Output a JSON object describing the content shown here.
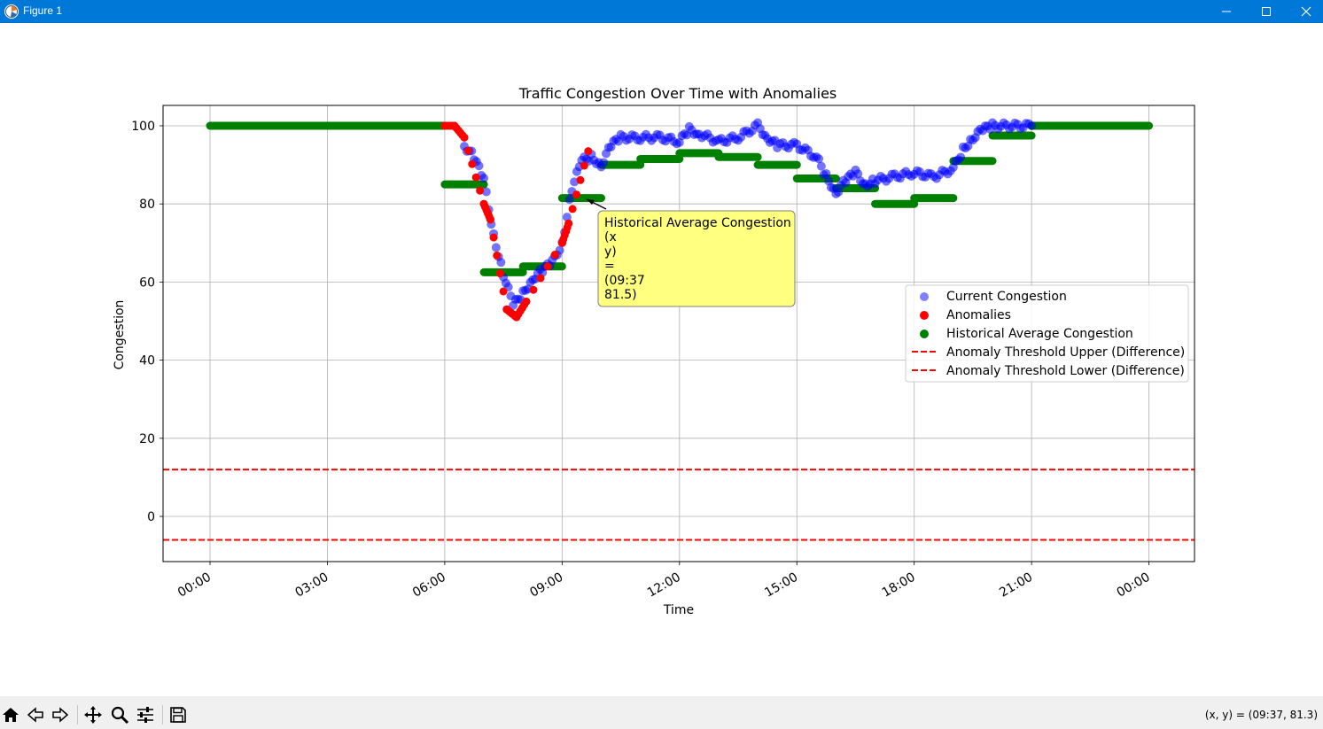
{
  "window": {
    "title": "Figure 1",
    "titlebar_color": "#0078d7",
    "controls": [
      "minimize-icon",
      "maximize-icon",
      "close-icon"
    ]
  },
  "chart_data": {
    "type": "scatter",
    "title": "Traffic Congestion Over Time with Anomalies",
    "xlabel": "Time",
    "ylabel": "Congestion",
    "xlim": [
      "23:14",
      "24:00 (+1h14)"
    ],
    "ylim": [
      -11.5,
      105
    ],
    "x_ticks": [
      "00:00",
      "03:00",
      "06:00",
      "09:00",
      "12:00",
      "15:00",
      "18:00",
      "21:00",
      "00:00"
    ],
    "y_ticks": [
      "0",
      "20",
      "40",
      "60",
      "80",
      "100"
    ],
    "grid": true,
    "legend_position": "center-right",
    "legend": [
      "Current Congestion",
      "Anomalies",
      "Historical Average Congestion",
      "Anomaly Threshold Upper (Difference)",
      "Anomaly Threshold Lower (Difference)"
    ],
    "colors": {
      "current": "#0000ff",
      "anomaly": "#ff0000",
      "historical": "#008000",
      "threshold": "#ff0000",
      "annotation_bg": "#ffff80"
    },
    "series": [
      {
        "name": "Current Congestion",
        "points": [
          [
            "06:30",
            95
          ],
          [
            "06:45",
            92
          ],
          [
            "07:00",
            86
          ],
          [
            "07:15",
            72
          ],
          [
            "07:30",
            62
          ],
          [
            "07:45",
            54
          ],
          [
            "08:00",
            57
          ],
          [
            "08:15",
            61
          ],
          [
            "08:30",
            63
          ],
          [
            "08:45",
            65
          ],
          [
            "09:00",
            70
          ],
          [
            "09:15",
            84
          ],
          [
            "09:30",
            91
          ],
          [
            "09:45",
            92
          ],
          [
            "10:00",
            90
          ],
          [
            "10:15",
            95
          ],
          [
            "10:30",
            97
          ],
          [
            "11:00",
            97
          ],
          [
            "11:30",
            97
          ],
          [
            "12:00",
            96
          ],
          [
            "12:15",
            99
          ],
          [
            "12:30",
            98
          ],
          [
            "13:00",
            96
          ],
          [
            "13:30",
            97
          ],
          [
            "14:00",
            100
          ],
          [
            "14:15",
            97
          ],
          [
            "14:30",
            95
          ],
          [
            "15:00",
            95
          ],
          [
            "15:30",
            92
          ],
          [
            "15:45",
            87
          ],
          [
            "16:00",
            83
          ],
          [
            "16:15",
            86
          ],
          [
            "16:30",
            88
          ],
          [
            "16:45",
            85
          ],
          [
            "17:00",
            86
          ],
          [
            "17:30",
            87
          ],
          [
            "18:00",
            88
          ],
          [
            "18:30",
            87
          ],
          [
            "19:00",
            89
          ],
          [
            "19:15",
            94
          ],
          [
            "19:30",
            97
          ],
          [
            "19:45",
            99
          ],
          [
            "20:00",
            100
          ],
          [
            "21:00",
            100
          ]
        ]
      },
      {
        "name": "Anomalies",
        "points": [
          [
            "06:00",
            100
          ],
          [
            "06:15",
            100
          ],
          [
            "06:30",
            97
          ],
          [
            "07:00",
            80
          ],
          [
            "07:10",
            76
          ],
          [
            "07:35",
            53
          ],
          [
            "07:50",
            51
          ],
          [
            "08:05",
            55
          ],
          [
            "09:00",
            70
          ],
          [
            "09:10",
            75
          ],
          [
            "09:40",
            93.5
          ]
        ]
      },
      {
        "name": "Historical Average Congestion",
        "segments": [
          [
            "00:00",
            "06:00",
            100
          ],
          [
            "06:00",
            "07:00",
            85
          ],
          [
            "07:00",
            "08:00",
            62.5
          ],
          [
            "08:00",
            "09:00",
            64
          ],
          [
            "09:00",
            "10:00",
            81.5
          ],
          [
            "10:00",
            "11:00",
            90
          ],
          [
            "11:00",
            "12:00",
            91.5
          ],
          [
            "12:00",
            "13:00",
            93
          ],
          [
            "13:00",
            "14:00",
            92
          ],
          [
            "14:00",
            "15:00",
            90
          ],
          [
            "15:00",
            "16:00",
            86.5
          ],
          [
            "16:00",
            "17:00",
            84
          ],
          [
            "17:00",
            "18:00",
            80
          ],
          [
            "18:00",
            "19:00",
            81.5
          ],
          [
            "19:00",
            "20:00",
            91
          ],
          [
            "20:00",
            "21:00",
            97.5
          ],
          [
            "21:00",
            "24:00",
            100
          ]
        ]
      },
      {
        "name": "Anomaly Threshold Upper (Difference)",
        "value": 12
      },
      {
        "name": "Anomaly Threshold Lower (Difference)",
        "value": -6
      }
    ],
    "annotation": {
      "lines": [
        "Historical Average Congestion",
        "(x",
        "y)",
        "=",
        "(09:37",
        "81.5)"
      ],
      "points_to": [
        "09:37",
        81.5
      ]
    }
  },
  "toolbar": {
    "buttons": [
      "home-icon",
      "back-icon",
      "forward-icon",
      "pan-icon",
      "zoom-icon",
      "configure-icon",
      "save-icon"
    ],
    "coords": "(x, y) = (09:37, 81.3)"
  }
}
